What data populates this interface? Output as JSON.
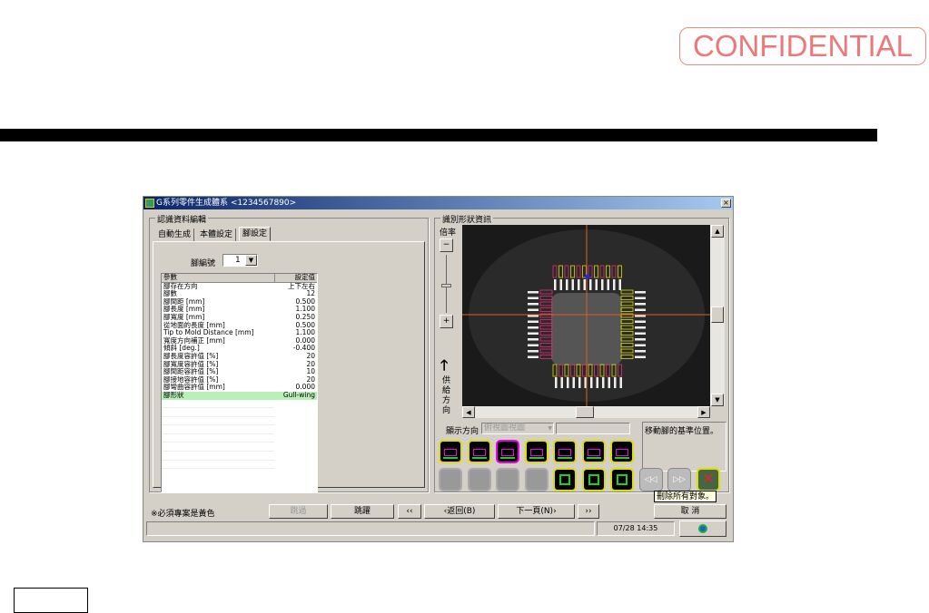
{
  "watermark": "CONFIDENTIAL",
  "window": {
    "title": "G系列零件生成體系 <1234567890>",
    "close": "×"
  },
  "left": {
    "group_label": "認識資料編輯",
    "tabs": [
      "自動生成",
      "本體設定",
      "腳設定"
    ],
    "active_tab": 2,
    "pin_no_label": "腳編號",
    "pin_no_value": "1",
    "table": {
      "headers": [
        "參數",
        "設定值"
      ],
      "rows": [
        [
          "腳存在方向",
          "上下左右"
        ],
        [
          "腳數",
          "12"
        ],
        [
          "腳間距 [mm]",
          "0.500"
        ],
        [
          "腳長度 [mm]",
          "1.100"
        ],
        [
          "腳寬度 [mm]",
          "0.250"
        ],
        [
          "從地面的長度 [mm]",
          "0.500"
        ],
        [
          "Tip to Mold Distance [mm]",
          "1.100"
        ],
        [
          "寬度方向補正 [mm]",
          "0.000"
        ],
        [
          "傾斜 [deg.]",
          "-0.400"
        ],
        [
          "腳長度容許值 [%]",
          "20"
        ],
        [
          "腳寬度容許值 [%]",
          "20"
        ],
        [
          "腳間距容許值 [%]",
          "10"
        ],
        [
          "腳接地容許值 [%]",
          "20"
        ],
        [
          "腳彎曲容許值 [mm]",
          "0.000"
        ],
        [
          "腳形狀",
          "Gull-wing"
        ]
      ],
      "highlight_row": 14
    }
  },
  "right": {
    "group_label": "識別形狀資訊",
    "zoom_label": "倍率",
    "zoom_minus": "−",
    "zoom_plus": "+",
    "supply_label": "供給方向",
    "display_dir_label": "顯示方向",
    "display_dir_value": "俯視圖視圖",
    "message": "移動腳的基準位置。",
    "tooltip": "刪除所有對象。"
  },
  "bottom": {
    "note": "※必須專案是黃色",
    "buttons": {
      "skip1": "跳過",
      "skip2": "跳躍",
      "first": "‹‹",
      "back": "‹返回(B)",
      "next": "下一頁(N)›",
      "last": "››",
      "cancel": "取 消"
    },
    "status_time": "07/28 14:35"
  },
  "colors": {
    "titlebar": "#0a246a",
    "highlight": "#b8f0b8",
    "pad_yellow": "#dddd00",
    "pad_magenta": "#e0307a",
    "crosshair": "#e06020"
  }
}
